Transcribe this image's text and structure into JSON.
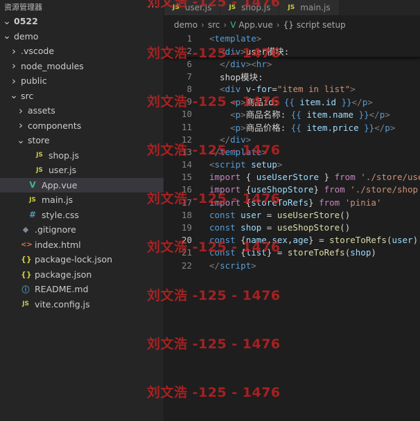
{
  "sidebar": {
    "title": "资源管理器",
    "more": "···",
    "tree": [
      {
        "label": "0522",
        "depth": 0,
        "chev": "v",
        "icon": "",
        "cls": "",
        "bold": true
      },
      {
        "label": "demo",
        "depth": 0,
        "chev": "v",
        "icon": "",
        "cls": ""
      },
      {
        "label": ".vscode",
        "depth": 1,
        "chev": ">",
        "icon": "",
        "cls": ""
      },
      {
        "label": "node_modules",
        "depth": 1,
        "chev": ">",
        "icon": "",
        "cls": ""
      },
      {
        "label": "public",
        "depth": 1,
        "chev": ">",
        "icon": "",
        "cls": ""
      },
      {
        "label": "src",
        "depth": 1,
        "chev": "v",
        "icon": "",
        "cls": ""
      },
      {
        "label": "assets",
        "depth": 2,
        "chev": ">",
        "icon": "",
        "cls": ""
      },
      {
        "label": "components",
        "depth": 2,
        "chev": ">",
        "icon": "",
        "cls": ""
      },
      {
        "label": "store",
        "depth": 2,
        "chev": "v",
        "icon": "",
        "cls": ""
      },
      {
        "label": "shop.js",
        "depth": 3,
        "chev": "",
        "icon": "JS",
        "cls": "js"
      },
      {
        "label": "user.js",
        "depth": 3,
        "chev": "",
        "icon": "JS",
        "cls": "js"
      },
      {
        "label": "App.vue",
        "depth": 2,
        "chev": "",
        "icon": "V",
        "cls": "vue",
        "selected": true
      },
      {
        "label": "main.js",
        "depth": 2,
        "chev": "",
        "icon": "JS",
        "cls": "js"
      },
      {
        "label": "style.css",
        "depth": 2,
        "chev": "",
        "icon": "#",
        "cls": "hash"
      },
      {
        "label": ".gitignore",
        "depth": 1,
        "chev": "",
        "icon": "◆",
        "cls": "git"
      },
      {
        "label": "index.html",
        "depth": 1,
        "chev": "",
        "icon": "<>",
        "cls": "html"
      },
      {
        "label": "package-lock.json",
        "depth": 1,
        "chev": "",
        "icon": "{}",
        "cls": "json"
      },
      {
        "label": "package.json",
        "depth": 1,
        "chev": "",
        "icon": "{}",
        "cls": "json"
      },
      {
        "label": "README.md",
        "depth": 1,
        "chev": "",
        "icon": "ⓘ",
        "cls": "info"
      },
      {
        "label": "vite.config.js",
        "depth": 1,
        "chev": "",
        "icon": "JS",
        "cls": "js"
      }
    ]
  },
  "tabs": [
    {
      "label": "user.js",
      "icon": "JS"
    },
    {
      "label": "shop.js",
      "icon": "JS"
    },
    {
      "label": "main.js",
      "icon": "JS"
    }
  ],
  "breadcrumb": {
    "parts": [
      "demo",
      "src"
    ],
    "file": "App.vue",
    "symbol": "script setup"
  },
  "editor": {
    "active_line": "20",
    "sticky": [
      {
        "n": "1",
        "tokens": [
          [
            "<",
            "t-punc"
          ],
          [
            "template",
            "t-tag"
          ],
          [
            ">",
            "t-punc"
          ]
        ]
      },
      {
        "n": "2",
        "tokens": [
          [
            "  ",
            "t-txt"
          ],
          [
            "<",
            "t-punc"
          ],
          [
            "div",
            "t-tag"
          ],
          [
            ">",
            "t-punc"
          ],
          [
            "user模块:",
            "t-txt"
          ]
        ]
      }
    ],
    "lines": [
      {
        "n": "6",
        "tokens": [
          [
            "  ",
            "t-txt"
          ],
          [
            "</",
            "t-punc"
          ],
          [
            "div",
            "t-tag"
          ],
          [
            "><",
            "t-punc"
          ],
          [
            "hr",
            "t-tag"
          ],
          [
            ">",
            "t-punc"
          ]
        ]
      },
      {
        "n": "7",
        "tokens": [
          [
            "  shop模块:",
            "t-txt"
          ]
        ]
      },
      {
        "n": "8",
        "tokens": [
          [
            "  ",
            "t-txt"
          ],
          [
            "<",
            "t-punc"
          ],
          [
            "div",
            "t-tag"
          ],
          [
            " ",
            "t-txt"
          ],
          [
            "v-for",
            "t-attr"
          ],
          [
            "=",
            "t-txt"
          ],
          [
            "\"item in list\"",
            "t-str"
          ],
          [
            ">",
            "t-punc"
          ]
        ]
      },
      {
        "n": "9",
        "tokens": [
          [
            "    ",
            "t-txt"
          ],
          [
            "<",
            "t-punc"
          ],
          [
            "p",
            "t-tag"
          ],
          [
            ">",
            "t-punc"
          ],
          [
            "商品id: ",
            "t-txt"
          ],
          [
            "{{ ",
            "t-interp"
          ],
          [
            "item.id",
            "t-var"
          ],
          [
            " }}",
            "t-interp"
          ],
          [
            "</",
            "t-punc"
          ],
          [
            "p",
            "t-tag"
          ],
          [
            ">",
            "t-punc"
          ]
        ]
      },
      {
        "n": "10",
        "tokens": [
          [
            "    ",
            "t-txt"
          ],
          [
            "<",
            "t-punc"
          ],
          [
            "p",
            "t-tag"
          ],
          [
            ">",
            "t-punc"
          ],
          [
            "商品名称: ",
            "t-txt"
          ],
          [
            "{{ ",
            "t-interp"
          ],
          [
            "item.name",
            "t-var"
          ],
          [
            " }}",
            "t-interp"
          ],
          [
            "</",
            "t-punc"
          ],
          [
            "p",
            "t-tag"
          ],
          [
            ">",
            "t-punc"
          ]
        ]
      },
      {
        "n": "11",
        "tokens": [
          [
            "    ",
            "t-txt"
          ],
          [
            "<",
            "t-punc"
          ],
          [
            "p",
            "t-tag"
          ],
          [
            ">",
            "t-punc"
          ],
          [
            "商品价格: ",
            "t-txt"
          ],
          [
            "{{ ",
            "t-interp"
          ],
          [
            "item.price",
            "t-var"
          ],
          [
            " }}",
            "t-interp"
          ],
          [
            "</",
            "t-punc"
          ],
          [
            "p",
            "t-tag"
          ],
          [
            ">",
            "t-punc"
          ]
        ]
      },
      {
        "n": "12",
        "tokens": [
          [
            "  ",
            "t-txt"
          ],
          [
            "</",
            "t-punc"
          ],
          [
            "div",
            "t-tag"
          ],
          [
            ">",
            "t-punc"
          ]
        ]
      },
      {
        "n": "13",
        "tokens": [
          [
            "</",
            "t-punc"
          ],
          [
            "template",
            "t-tag"
          ],
          [
            ">",
            "t-punc"
          ]
        ]
      },
      {
        "n": "14",
        "tokens": [
          [
            "<",
            "t-punc"
          ],
          [
            "script",
            "t-tag"
          ],
          [
            " ",
            "t-txt"
          ],
          [
            "setup",
            "t-attr"
          ],
          [
            ">",
            "t-punc"
          ]
        ]
      },
      {
        "n": "15",
        "tokens": [
          [
            "import",
            "t-kw"
          ],
          [
            " { ",
            "t-txt"
          ],
          [
            "useUserStore",
            "t-var"
          ],
          [
            " } ",
            "t-txt"
          ],
          [
            "from",
            "t-kw"
          ],
          [
            " ",
            "t-txt"
          ],
          [
            "'./store/use",
            "t-str"
          ]
        ]
      },
      {
        "n": "16",
        "tokens": [
          [
            "import",
            "t-kw"
          ],
          [
            " {",
            "t-txt"
          ],
          [
            "useShopStore",
            "t-var"
          ],
          [
            "} ",
            "t-txt"
          ],
          [
            "from",
            "t-kw"
          ],
          [
            " ",
            "t-txt"
          ],
          [
            "'./store/shop.",
            "t-str"
          ]
        ]
      },
      {
        "n": "17",
        "tokens": [
          [
            "import",
            "t-kw"
          ],
          [
            " {",
            "t-txt"
          ],
          [
            "storeToRefs",
            "t-var"
          ],
          [
            "} ",
            "t-txt"
          ],
          [
            "from",
            "t-kw"
          ],
          [
            " ",
            "t-txt"
          ],
          [
            "'pinia'",
            "t-str"
          ]
        ]
      },
      {
        "n": "18",
        "tokens": [
          [
            "const",
            "t-dec"
          ],
          [
            " ",
            "t-txt"
          ],
          [
            "user",
            "t-var"
          ],
          [
            " = ",
            "t-txt"
          ],
          [
            "useUserStore",
            "t-fn"
          ],
          [
            "()",
            "t-txt"
          ]
        ]
      },
      {
        "n": "19",
        "tokens": [
          [
            "const",
            "t-dec"
          ],
          [
            " ",
            "t-txt"
          ],
          [
            "shop",
            "t-var"
          ],
          [
            " = ",
            "t-txt"
          ],
          [
            "useShopStore",
            "t-fn"
          ],
          [
            "()",
            "t-txt"
          ]
        ]
      },
      {
        "n": "20",
        "tokens": [
          [
            "const",
            "t-dec"
          ],
          [
            " {",
            "t-txt"
          ],
          [
            "name",
            "t-var"
          ],
          [
            ",",
            "t-txt"
          ],
          [
            "sex",
            "t-var"
          ],
          [
            ",",
            "t-txt"
          ],
          [
            "age",
            "t-var"
          ],
          [
            "} = ",
            "t-txt"
          ],
          [
            "storeToRefs",
            "t-fn"
          ],
          [
            "(",
            "t-txt"
          ],
          [
            "user",
            "t-var"
          ],
          [
            ")",
            "t-txt"
          ]
        ]
      },
      {
        "n": "21",
        "tokens": [
          [
            "const",
            "t-dec"
          ],
          [
            " {",
            "t-txt"
          ],
          [
            "list",
            "t-var"
          ],
          [
            "} = ",
            "t-txt"
          ],
          [
            "storeToRefs",
            "t-fn"
          ],
          [
            "(",
            "t-txt"
          ],
          [
            "shop",
            "t-var"
          ],
          [
            ")",
            "t-txt"
          ]
        ]
      },
      {
        "n": "22",
        "tokens": [
          [
            "</",
            "t-punc"
          ],
          [
            "script",
            "t-tag"
          ],
          [
            ">",
            "t-punc"
          ]
        ]
      }
    ]
  },
  "watermark": {
    "text": "刘文浩 -125 - 1476",
    "rows": [
      "0",
      "1",
      "2",
      "3",
      "4",
      "5",
      "6",
      "7",
      "8"
    ]
  }
}
